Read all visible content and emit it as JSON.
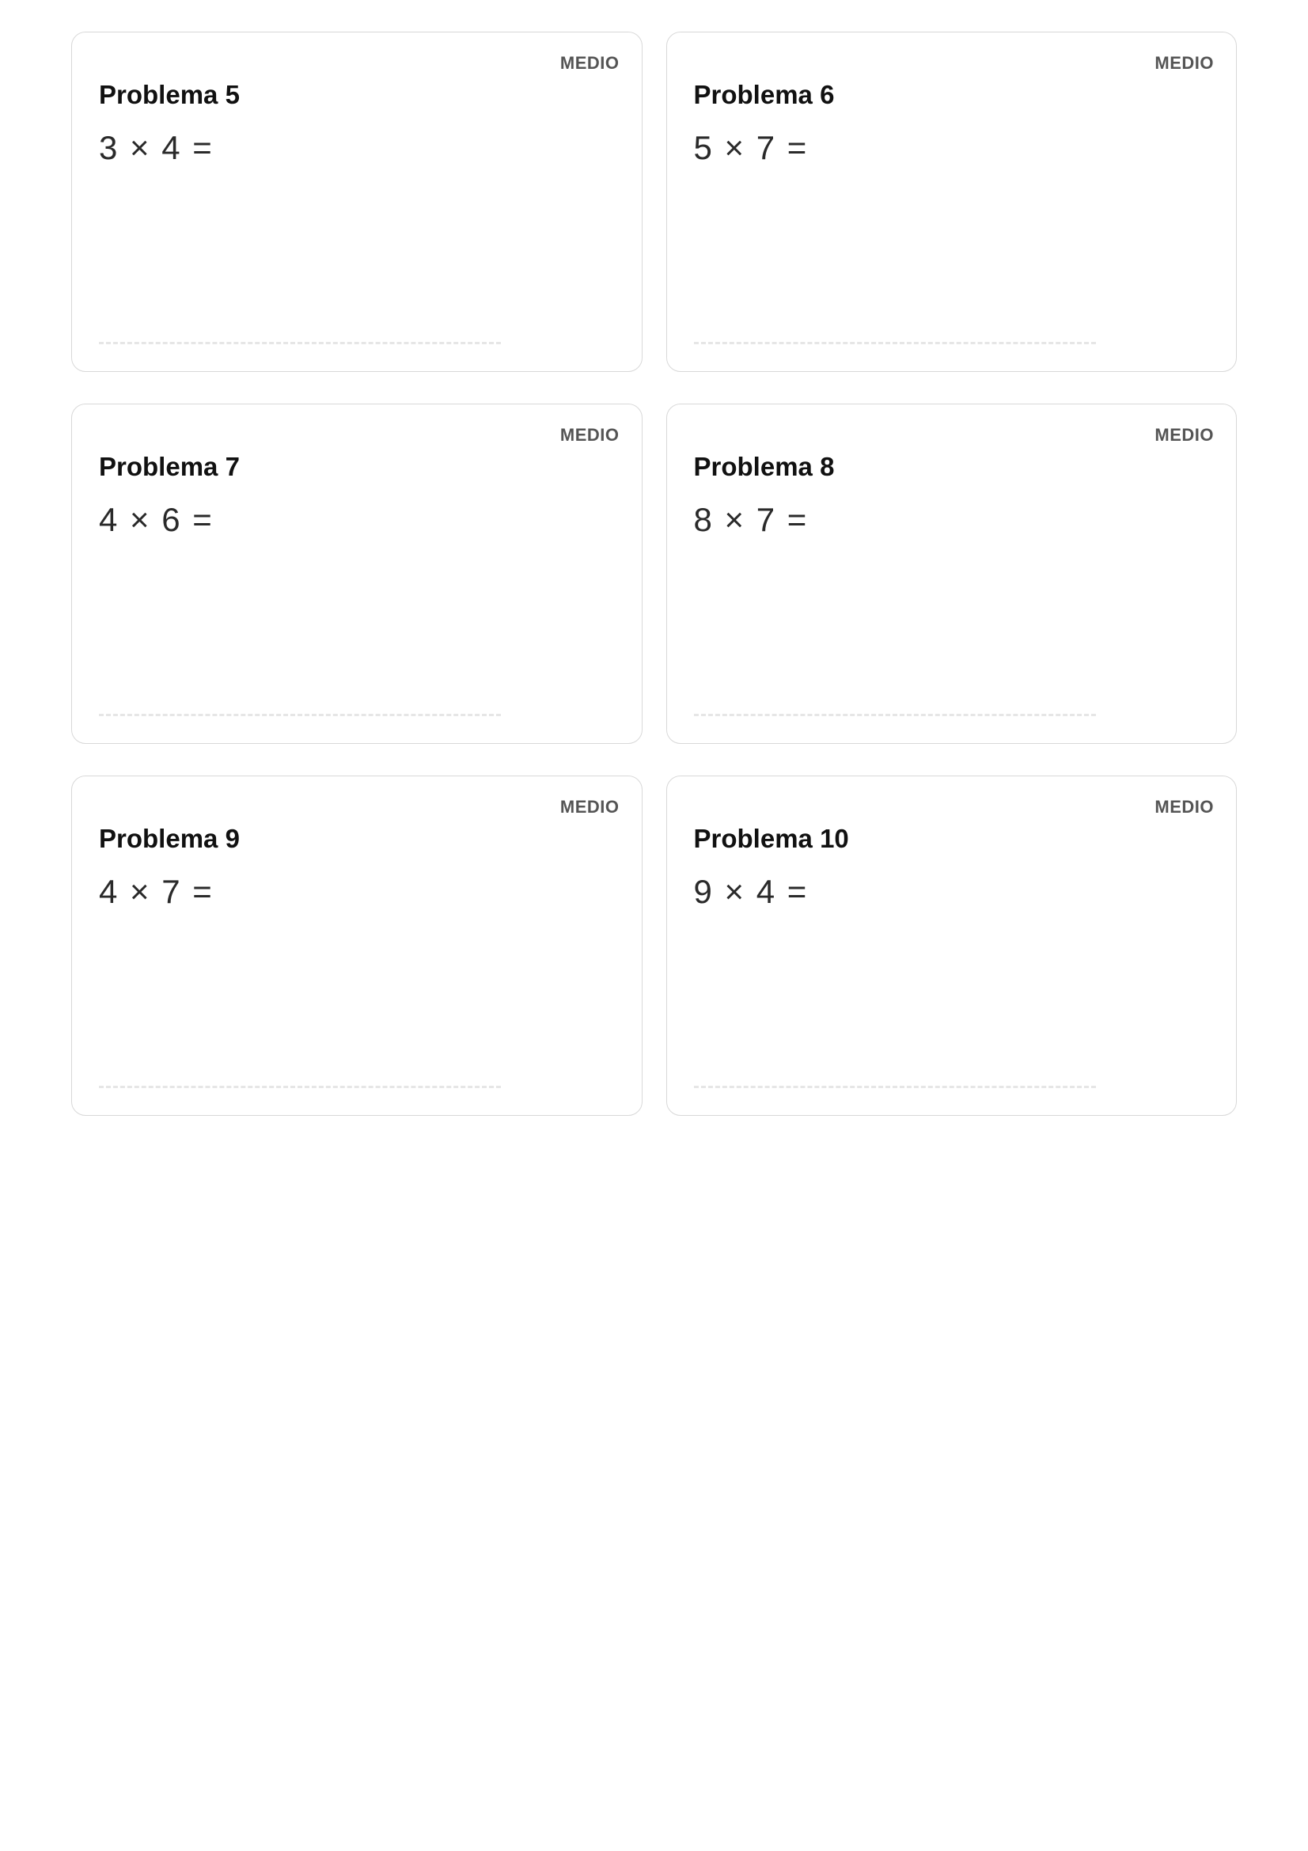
{
  "difficulty_label": "MEDIO",
  "problem_label_prefix": "Problema",
  "problems": [
    {
      "number": 5,
      "equation": "3 × 4 ="
    },
    {
      "number": 6,
      "equation": "5 × 7 ="
    },
    {
      "number": 7,
      "equation": "4 × 6 ="
    },
    {
      "number": 8,
      "equation": "8 × 7 ="
    },
    {
      "number": 9,
      "equation": "4 × 7 ="
    },
    {
      "number": 10,
      "equation": "9 × 4 ="
    }
  ]
}
